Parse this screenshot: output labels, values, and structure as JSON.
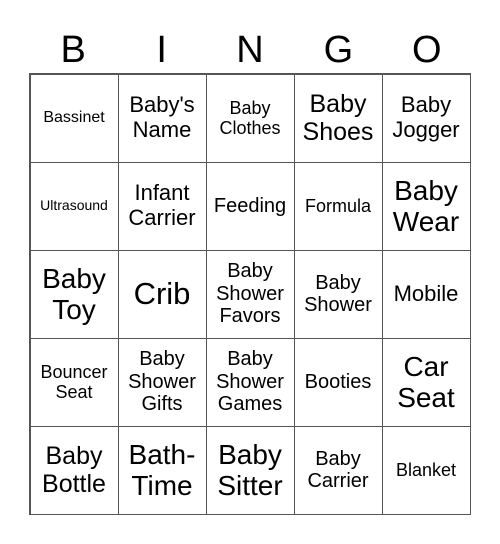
{
  "header": [
    "B",
    "I",
    "N",
    "G",
    "O"
  ],
  "cells": [
    [
      "Bassinet",
      "Baby's Name",
      "Baby Clothes",
      "Baby Shoes",
      "Baby Jogger"
    ],
    [
      "Ultrasound",
      "Infant Carrier",
      "Feeding",
      "Formula",
      "Baby Wear"
    ],
    [
      "Baby Toy",
      "Crib",
      "Baby Shower Favors",
      "Baby Shower",
      "Mobile"
    ],
    [
      "Bouncer Seat",
      "Baby Shower Gifts",
      "Baby Shower Games",
      "Booties",
      "Car Seat"
    ],
    [
      "Baby Bottle",
      "Bath-Time",
      "Baby Sitter",
      "Baby Carrier",
      "Blanket"
    ]
  ]
}
